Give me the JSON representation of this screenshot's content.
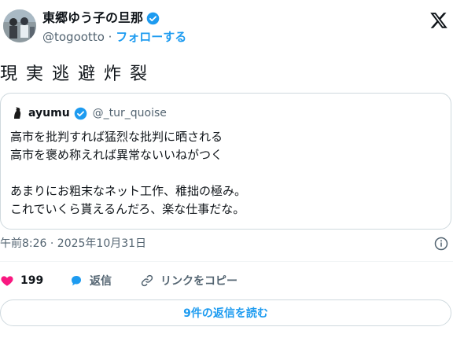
{
  "author": {
    "name": "東郷ゆう子の旦那",
    "handle": "@togootto",
    "separator": " · ",
    "follow_label": "フォローする"
  },
  "tweet": {
    "text": "現実逃避炸裂"
  },
  "quote": {
    "name": "ayumu",
    "handle": "@_tur_quoise",
    "lines": [
      "高市を批判すれば猛烈な批判に晒される",
      "高市を褒め称えれば異常ないいねがつく",
      "",
      "あまりにお粗末なネット工作、稚拙の極み。",
      "これでいくら貰えるんだろ、楽な仕事だな。"
    ]
  },
  "timestamp": "午前8:26 · 2025年10月31日",
  "actions": {
    "like_count": "199",
    "reply_label": "返信",
    "copy_link_label": "リンクをコピー"
  },
  "replies_button_label": "9件の返信を読む",
  "colors": {
    "accent": "#1d9bf0",
    "like": "#f91880",
    "text": "#0f1419",
    "secondary": "#536471",
    "border": "#cfd9de"
  },
  "icons": {
    "verified": "verified-badge-icon",
    "logo": "x-logo-icon",
    "info": "info-icon",
    "like": "heart-icon",
    "reply": "speech-bubble-icon",
    "copy": "link-icon"
  }
}
